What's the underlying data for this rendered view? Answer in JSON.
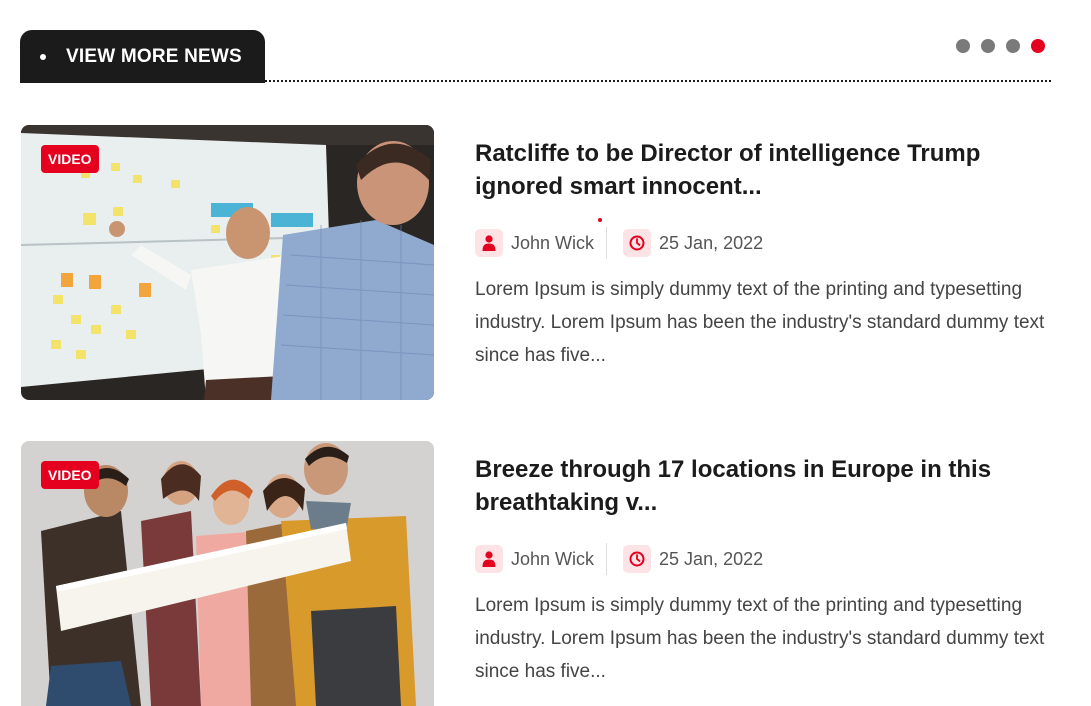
{
  "header": {
    "title": "VIEW MORE NEWS",
    "pager_dots": 4,
    "active_dot": 4,
    "accent_color": "#e5001f"
  },
  "articles": [
    {
      "badge": "VIDEO",
      "title": "Ratcliffe to be Director of intelligence Trump ignored smart innocent...",
      "author": "John Wick",
      "date": "25 Jan, 2022",
      "excerpt": "Lorem Ipsum is simply dummy text of the printing and typesetting industry. Lorem Ipsum has been the industry's standard dummy text since has five...",
      "image": "office-whiteboard-meeting-photo"
    },
    {
      "badge": "VIDEO",
      "title": "Breeze through 17 locations in Europe in this breathtaking v...",
      "author": "John Wick",
      "date": "25 Jan, 2022",
      "excerpt": "Lorem Ipsum is simply dummy text of the printing and typesetting industry. Lorem Ipsum has been the industry's standard dummy text since has five...",
      "image": "group-of-friends-holding-banner-photo"
    }
  ],
  "icons": {
    "author": "user-icon",
    "date": "clock-icon"
  }
}
